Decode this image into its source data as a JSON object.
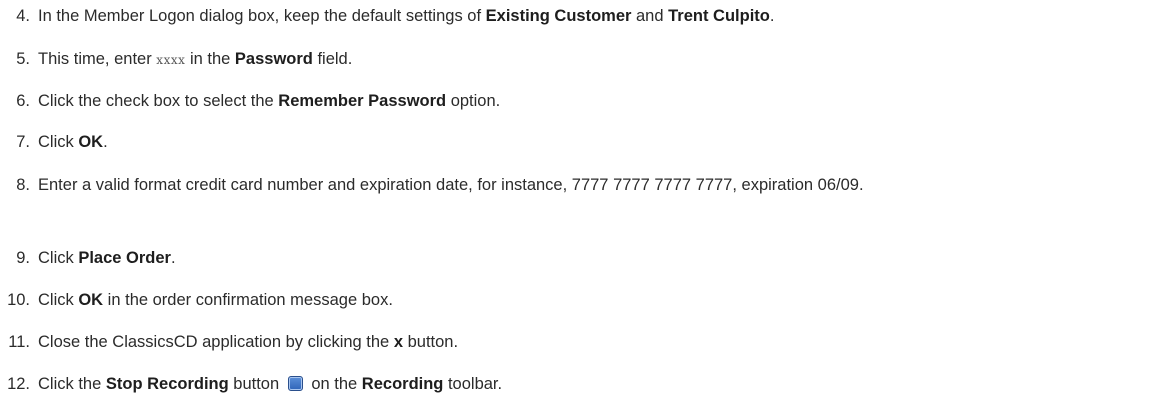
{
  "steps": [
    {
      "n": "4.",
      "parts": [
        {
          "t": "In the Member Logon dialog box, keep the default settings of "
        },
        {
          "t": "Existing Customer",
          "b": true
        },
        {
          "t": " and "
        },
        {
          "t": "Trent Culpito",
          "b": true
        },
        {
          "t": "."
        }
      ]
    },
    {
      "n": "5.",
      "parts": [
        {
          "t": "This time, enter "
        },
        {
          "t": "xxxx",
          "code": true
        },
        {
          "t": " in the "
        },
        {
          "t": "Password",
          "b": true
        },
        {
          "t": " field."
        }
      ]
    },
    {
      "n": "6.",
      "parts": [
        {
          "t": "Click the check box to select the "
        },
        {
          "t": "Remember Password",
          "b": true
        },
        {
          "t": " option."
        }
      ]
    },
    {
      "n": "7.",
      "parts": [
        {
          "t": "Click "
        },
        {
          "t": "OK",
          "b": true
        },
        {
          "t": "."
        }
      ]
    },
    {
      "n": "8.",
      "parts": [
        {
          "t": "Enter a valid format credit card number and expiration date, for instance, 7777 7777 7777 7777, expiration 06/09."
        }
      ]
    },
    {
      "n": "9.",
      "parts": [
        {
          "t": "Click "
        },
        {
          "t": "Place Order",
          "b": true
        },
        {
          "t": "."
        }
      ]
    },
    {
      "n": "10.",
      "parts": [
        {
          "t": "Click "
        },
        {
          "t": "OK",
          "b": true
        },
        {
          "t": " in the order confirmation message box."
        }
      ]
    },
    {
      "n": "11.",
      "parts": [
        {
          "t": "Close the ClassicsCD application by clicking the "
        },
        {
          "t": "x",
          "b": true
        },
        {
          "t": " button."
        }
      ]
    },
    {
      "n": "12.",
      "parts": [
        {
          "t": "Click the "
        },
        {
          "t": "Stop Recording",
          "b": true
        },
        {
          "t": " button "
        },
        {
          "icon": "stop-recording-icon"
        },
        {
          "t": " on the "
        },
        {
          "t": "Recording",
          "b": true
        },
        {
          "t": " toolbar."
        }
      ]
    }
  ]
}
